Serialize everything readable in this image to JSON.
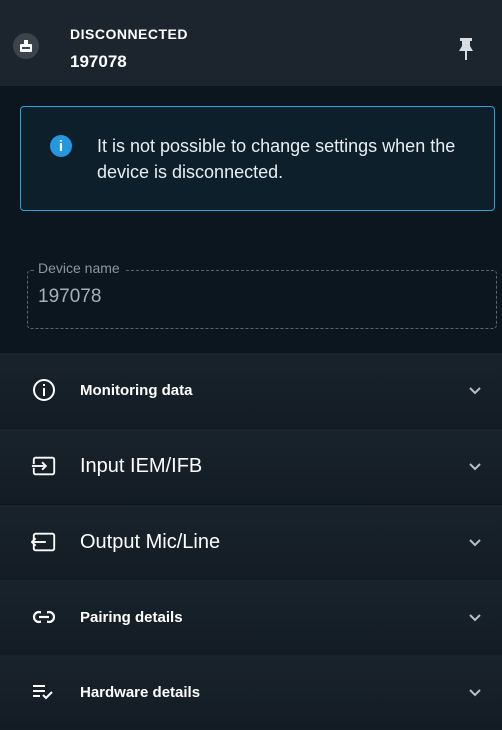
{
  "header": {
    "status": "DISCONNECTED",
    "device_id": "197078",
    "icons": [
      "device-icon",
      "pin-icon"
    ]
  },
  "info_banner": {
    "message": "It is not possible to change settings when the device is disconnected.",
    "icon": "info-icon"
  },
  "device_name_field": {
    "label": "Device name",
    "value": "197078"
  },
  "sections": [
    {
      "label": "Monitoring data",
      "icon": "info-outline-icon"
    },
    {
      "label": "Input IEM/IFB",
      "icon": "input-icon"
    },
    {
      "label": "Output Mic/Line",
      "icon": "output-icon"
    },
    {
      "label": "Pairing details",
      "icon": "link-icon"
    },
    {
      "label": "Hardware details",
      "icon": "list-check-icon"
    }
  ],
  "colors": {
    "accent": "#2aa3d8",
    "info_icon": "#2497e0",
    "background": "#0c161e",
    "header": "#1c252d"
  }
}
